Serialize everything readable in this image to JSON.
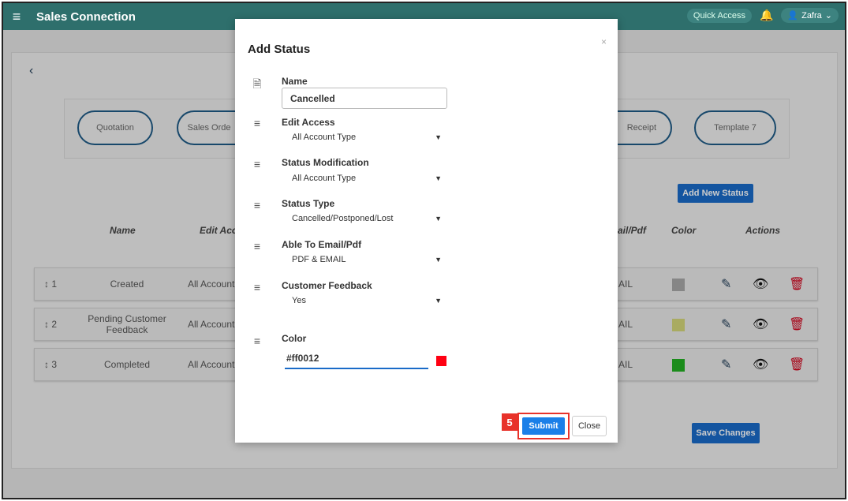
{
  "app": {
    "title": "Sales Connection",
    "quick_access": "Quick Access",
    "user": "Zafra"
  },
  "templates": [
    "Quotation",
    "Sales Orde",
    "Receipt",
    "Template 7"
  ],
  "buttons": {
    "add_status": "Add New Status",
    "save_changes": "Save Changes"
  },
  "table": {
    "headers": {
      "name": "Name",
      "edit_access": "Edit Acce",
      "email_pdf": "ail/Pdf",
      "color": "Color",
      "actions": "Actions"
    },
    "rows": [
      {
        "order": "1",
        "name": "Created",
        "edit_access": "All Account",
        "email": "AIL",
        "color": "#a8a8a8"
      },
      {
        "order": "2",
        "name": "Pending Customer Feedback",
        "edit_access": "All Account",
        "email": "AIL",
        "color": "#d4d67a"
      },
      {
        "order": "3",
        "name": "Completed",
        "edit_access": "All Account",
        "email": "AIL",
        "color": "#22b022"
      }
    ]
  },
  "modal": {
    "title": "Add Status",
    "close_x": "×",
    "name_label": "Name",
    "name_value": "Cancelled",
    "edit_access_label": "Edit Access",
    "edit_access_value": "All Account Type",
    "status_mod_label": "Status Modification",
    "status_mod_value": "All Account Type",
    "status_type_label": "Status Type",
    "status_type_value": "Cancelled/Postponed/Lost",
    "email_label": "Able To Email/Pdf",
    "email_value": "PDF & EMAIL",
    "feedback_label": "Customer Feedback",
    "feedback_value": "Yes",
    "color_label": "Color",
    "color_value": "#ff0012",
    "submit": "Submit",
    "close": "Close",
    "step": "5"
  },
  "colors": {
    "topbar": "#2e6f6c",
    "primary_button": "#1a6bc8",
    "highlight": "#e8322a"
  }
}
